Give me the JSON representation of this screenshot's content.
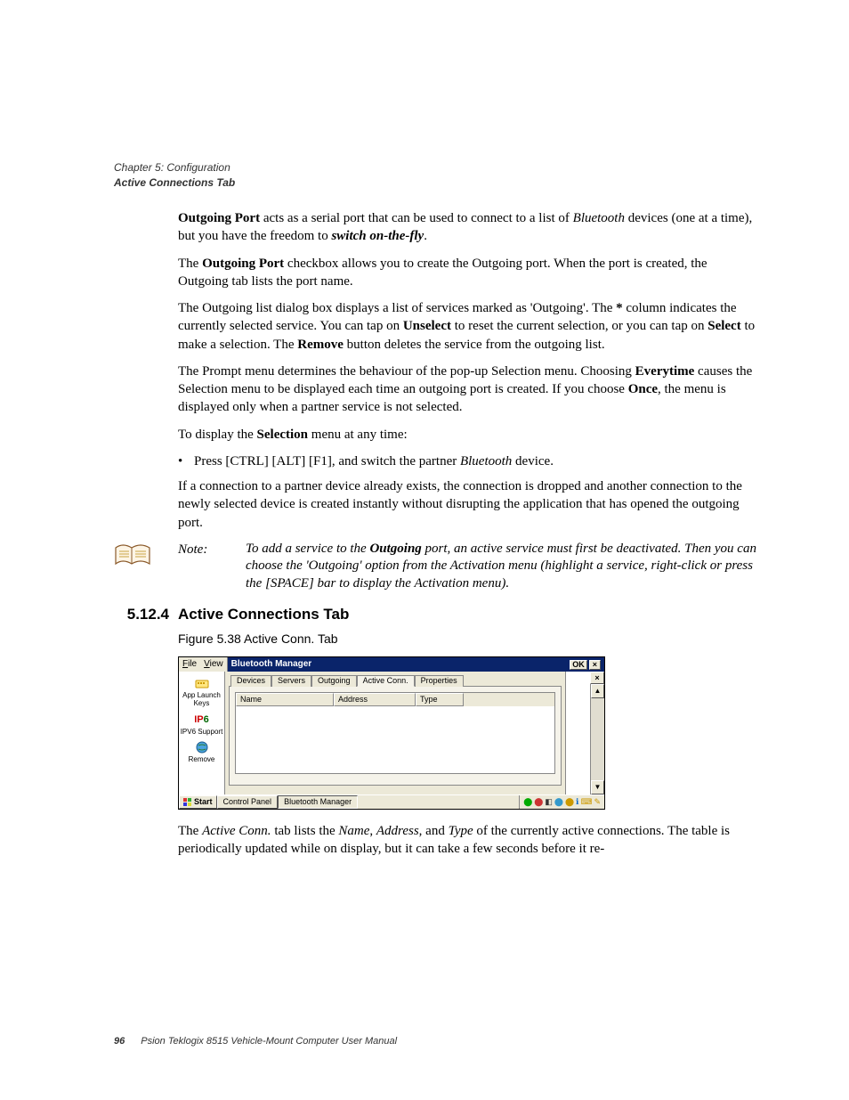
{
  "running_head": {
    "line1": "Chapter 5: Configuration",
    "line2": "Active Connections Tab"
  },
  "body": {
    "p1_a": "Outgoing Port",
    "p1_b": " acts as a serial port that can be used to connect to a list of ",
    "p1_c": "Bluetooth",
    "p1_d": " devices (one at a time), but you have the freedom to ",
    "p1_e": "switch on-the-fly",
    "p1_f": ".",
    "p2_a": "The ",
    "p2_b": "Outgoing Port",
    "p2_c": " checkbox allows you to create the Outgoing port. When the port is created, the Outgoing tab lists the port name.",
    "p3_a": "The Outgoing list dialog box displays a list of services marked as 'Outgoing'. The ",
    "p3_b": "*",
    "p3_c": " column indicates the currently selected service. You can tap on ",
    "p3_d": "Unselect",
    "p3_e": " to reset the current selection, or you can tap on ",
    "p3_f": "Select",
    "p3_g": " to make a selection. The ",
    "p3_h": "Remove",
    "p3_i": " button deletes the service from the outgoing list.",
    "p4_a": "The Prompt menu determines the behaviour of the pop-up Selection menu. Choosing ",
    "p4_b": "Everytime",
    "p4_c": " causes the Selection menu to be displayed each time an outgoing port is created. If you choose ",
    "p4_d": "Once",
    "p4_e": ", the menu is displayed only when a partner service is not selected.",
    "p5_a": "To display the ",
    "p5_b": "Selection",
    "p5_c": " menu at any time:",
    "bullet_a": "Press [CTRL] [ALT] [F1], and switch the partner ",
    "bullet_b": "Bluetooth",
    "bullet_c": " device.",
    "p7": "If a connection to a partner device already exists, the connection is dropped and another connection to the newly selected device is created instantly without disrupting the application that has opened the outgoing port."
  },
  "note": {
    "label": "Note:",
    "text_a": "To add a service to the ",
    "text_b": "Outgoing",
    "text_c": " port, an active service must first be deactivated. Then you can choose the 'Outgoing' option from the Activation menu (highlight a service, right-click or press the [SPACE] bar to display the Activation menu)."
  },
  "section": {
    "number": "5.12.4",
    "title": "Active Connections Tab"
  },
  "figure_caption": "Figure 5.38 Active Conn. Tab",
  "screenshot": {
    "menu": {
      "file": "File",
      "view": "View"
    },
    "window_title": "Bluetooth Manager",
    "ok": "OK",
    "close": "×",
    "sidebar": {
      "item1": "App Launch Keys",
      "item2": "IPV6 Support",
      "item3": "Remove"
    },
    "tabs": {
      "devices": "Devices",
      "servers": "Servers",
      "outgoing": "Outgoing",
      "active": "Active Conn.",
      "properties": "Properties"
    },
    "columns": {
      "name": "Name",
      "address": "Address",
      "type": "Type"
    },
    "taskbar": {
      "start": "Start",
      "task1": "Control Panel",
      "task2": "Bluetooth Manager"
    }
  },
  "after": {
    "p_a": "The ",
    "p_b": "Active Conn.",
    "p_c": " tab lists the ",
    "p_d": "Name",
    "p_e": ", ",
    "p_f": "Address",
    "p_g": ", and ",
    "p_h": "Type",
    "p_i": " of the currently active connections. The table is periodically updated while on display, but it can take a few seconds before it re-"
  },
  "footer": {
    "page": "96",
    "text": "Psion Teklogix 8515 Vehicle-Mount Computer User Manual"
  }
}
